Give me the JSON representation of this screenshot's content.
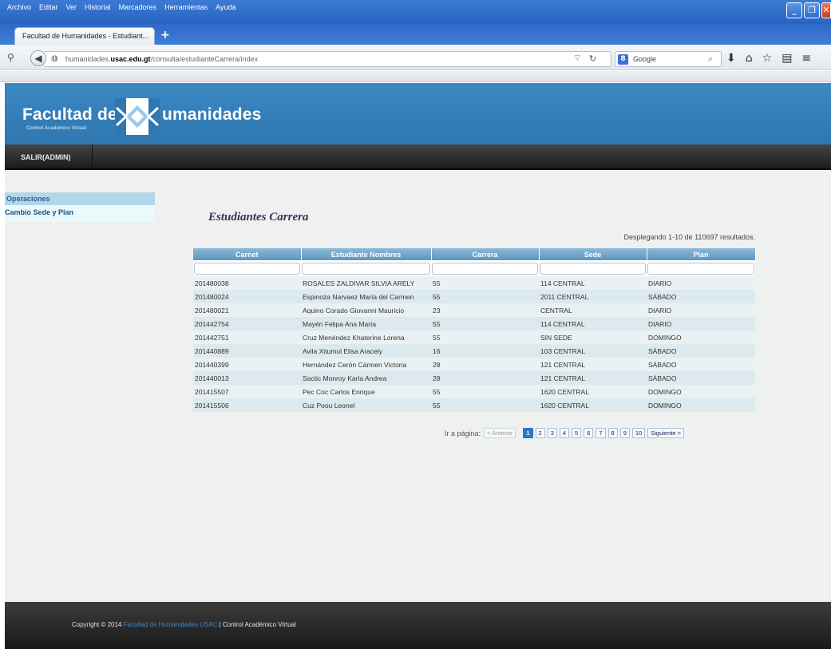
{
  "browser": {
    "menu": [
      "Archivo",
      "Editar",
      "Ver",
      "Historial",
      "Marcadores",
      "Herramientas",
      "Ayuda"
    ],
    "tab_title": "Facultad de Humanidades - Estudiant...",
    "url_prefix": "humanidades.",
    "url_domain": "usac.edu.gt",
    "url_path": "/consulta/estudianteCarrera/index",
    "search_placeholder": "Google"
  },
  "site": {
    "logo_part1": "Facultad de",
    "logo_part2": "umanidades",
    "logo_subtitle": "Control Académico Virtual",
    "nav_logout": "SALIR(ADMIN)"
  },
  "sidebar": {
    "heading": "Operaciones",
    "items": [
      {
        "label": "Cambio Sede y Plan"
      }
    ]
  },
  "main": {
    "title": "Estudiantes Carrera",
    "summary": "Desplegando 1-10 de 110697 resultados.",
    "columns": [
      "Carnet",
      "Estudiante Nombres",
      "Carrera",
      "Sede",
      "Plan"
    ],
    "rows": [
      [
        "201480038",
        "ROSALES ZALDIVAR SILVIA ARELY",
        "55",
        "114 CENTRAL",
        "DIARIO"
      ],
      [
        "201480024",
        "Espinoza Narvaez María del Carmen",
        "55",
        "2011 CENTRAL",
        "SÁBADO"
      ],
      [
        "201480021",
        "Aquino Corado Giovanni Mauricio",
        "23",
        "CENTRAL",
        "DIARIO"
      ],
      [
        "201442754",
        "Mayén Felipa Ana María",
        "55",
        "114 CENTRAL",
        "DIARIO"
      ],
      [
        "201442751",
        "Cruz Menéndez Khaterine Lorena",
        "55",
        "SIN SEDE",
        "DOMINGO"
      ],
      [
        "201440889",
        "Avila Xitumul Elisa Aracely",
        "16",
        "103 CENTRAL",
        "SÁBADO"
      ],
      [
        "201440399",
        "Hernández Cerón Cármen Victoria",
        "28",
        "121 CENTRAL",
        "SÁBADO"
      ],
      [
        "201440013",
        "Sactic Monroy Karla Andrea",
        "28",
        "121 CENTRAL",
        "SÁBADO"
      ],
      [
        "201415507",
        "Pec Coc Carlos Enrique",
        "55",
        "1620 CENTRAL",
        "DOMINGO"
      ],
      [
        "201415506",
        "Cuz Poou Leonel",
        "55",
        "1620 CENTRAL",
        "DOMINGO"
      ]
    ]
  },
  "pager": {
    "label": "Ir a página:",
    "prev": "< Anterior",
    "pages": [
      "1",
      "2",
      "3",
      "4",
      "5",
      "6",
      "7",
      "8",
      "9",
      "10"
    ],
    "current": "1",
    "next": "Siguiente >"
  },
  "footer": {
    "prefix": "Copyright © 2014 ",
    "link": "Facultad de Humanidades USAC",
    "suffix": " | Control Académico Virtual"
  },
  "colors": {
    "header_blue": "#3b88c2",
    "nav_dark": "#2a2a2a",
    "table_header": "#5b97c2",
    "footer_link": "#3f86c6"
  }
}
